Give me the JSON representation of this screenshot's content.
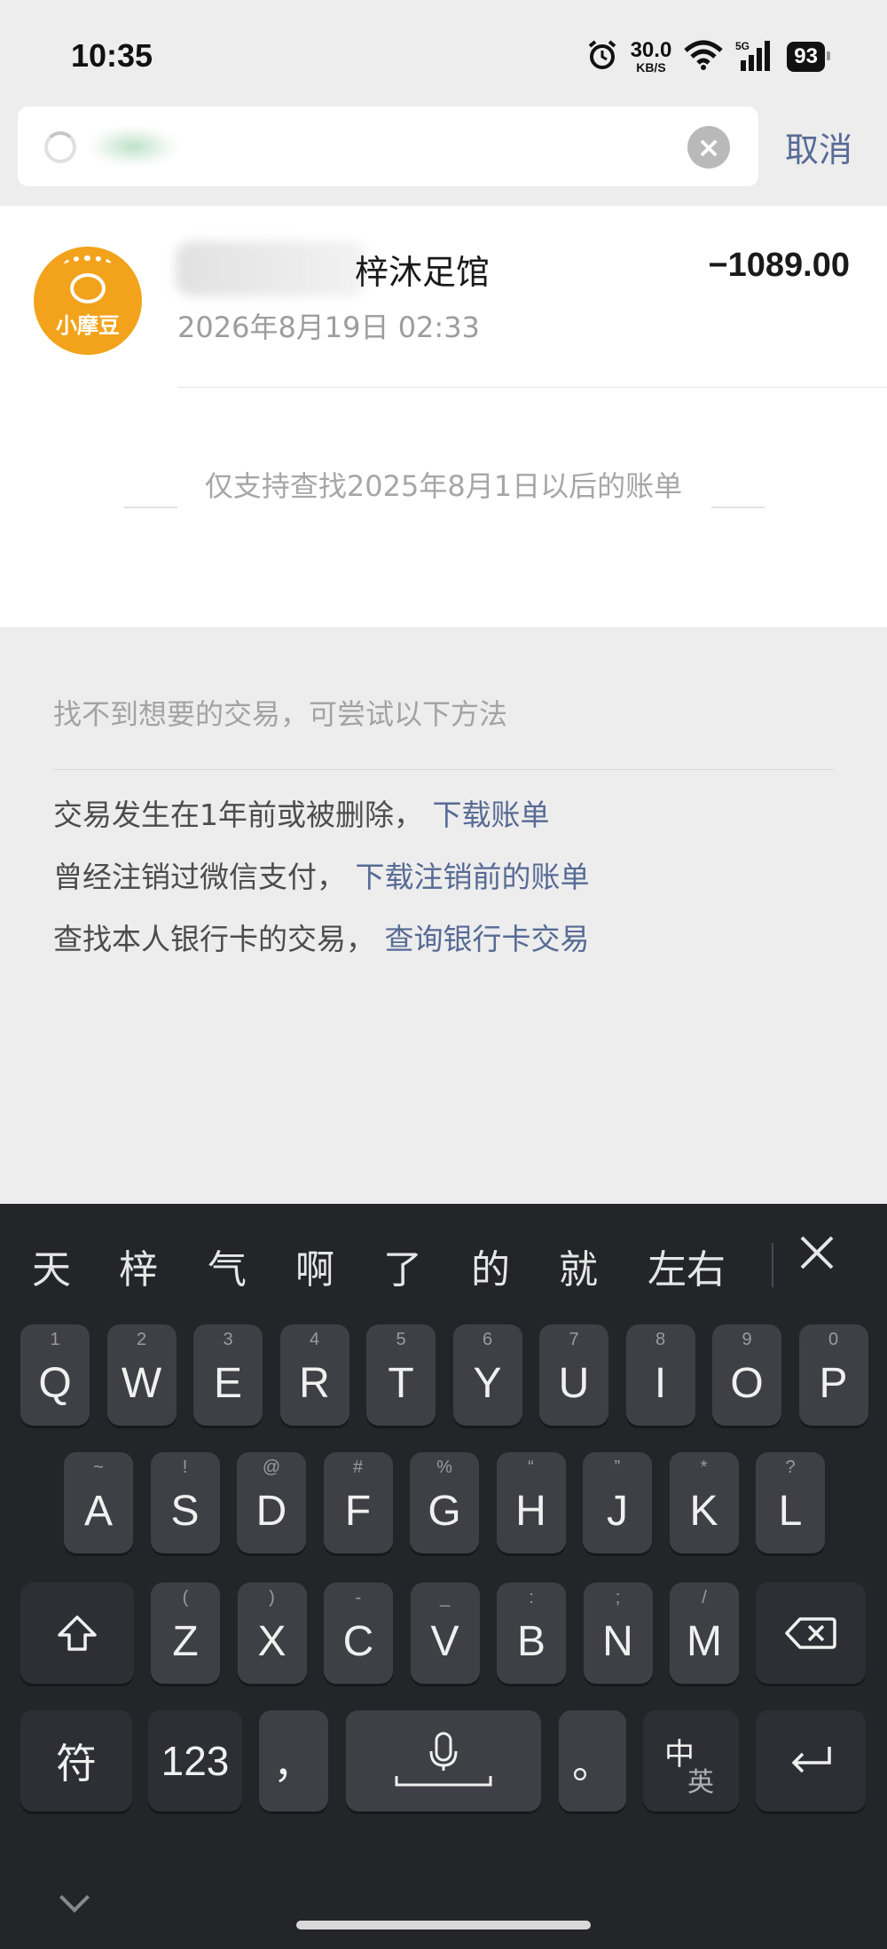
{
  "status_bar": {
    "time": "10:35",
    "net_speed": "30.0",
    "net_unit": "KB/S",
    "network": "5G",
    "battery": "93"
  },
  "search": {
    "cancel_label": "取消"
  },
  "result": {
    "name_suffix": "梓沐足馆",
    "amount": "−1089.00",
    "date": "2026年8月19日 02:33",
    "logo_text": "小摩豆",
    "limit_note": "仅支持查找2025年8月1日以后的账单"
  },
  "help": {
    "title": "找不到想要的交易，可尝试以下方法",
    "items": [
      {
        "text": "交易发生在1年前或被删除，",
        "link": "下载账单"
      },
      {
        "text": "曾经注销过微信支付，",
        "link": "下载注销前的账单"
      },
      {
        "text": "查找本人银行卡的交易，",
        "link": "查询银行卡交易"
      }
    ]
  },
  "keyboard": {
    "candidates": [
      "天",
      "梓",
      "气",
      "啊",
      "了",
      "的",
      "就",
      "左右"
    ],
    "row1": [
      {
        "k": "Q",
        "s": "1"
      },
      {
        "k": "W",
        "s": "2"
      },
      {
        "k": "E",
        "s": "3"
      },
      {
        "k": "R",
        "s": "4"
      },
      {
        "k": "T",
        "s": "5"
      },
      {
        "k": "Y",
        "s": "6"
      },
      {
        "k": "U",
        "s": "7"
      },
      {
        "k": "I",
        "s": "8"
      },
      {
        "k": "O",
        "s": "9"
      },
      {
        "k": "P",
        "s": "0"
      }
    ],
    "row2": [
      {
        "k": "A",
        "s": "~"
      },
      {
        "k": "S",
        "s": "!"
      },
      {
        "k": "D",
        "s": "@"
      },
      {
        "k": "F",
        "s": "#"
      },
      {
        "k": "G",
        "s": "%"
      },
      {
        "k": "H",
        "s": "“"
      },
      {
        "k": "J",
        "s": "”"
      },
      {
        "k": "K",
        "s": "*"
      },
      {
        "k": "L",
        "s": "?"
      }
    ],
    "row3": [
      {
        "k": "Z",
        "s": "("
      },
      {
        "k": "X",
        "s": ")"
      },
      {
        "k": "C",
        "s": "-"
      },
      {
        "k": "V",
        "s": "_"
      },
      {
        "k": "B",
        "s": ":"
      },
      {
        "k": "N",
        "s": ";"
      },
      {
        "k": "M",
        "s": "/"
      }
    ],
    "symbol_label": "符",
    "num_label": "123",
    "comma": "，",
    "period": "。",
    "zh_label": "中",
    "en_label": "英"
  }
}
